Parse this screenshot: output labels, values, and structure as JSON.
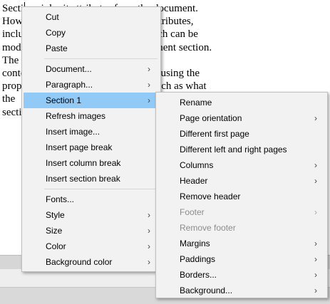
{
  "document": {
    "text": "Sections inherit attributes from the document.\nHowever, they can have their own attributes,\nincluding page size, orientation, which can be\nmodified independently of the document section. The\ncontent within a section is formatted using the\nproperties defined for that section, such as what the\nsection is"
  },
  "main_menu": {
    "cut": "Cut",
    "copy": "Copy",
    "paste": "Paste",
    "document": "Document...",
    "paragraph": "Paragraph...",
    "section": "Section 1",
    "refresh_images": "Refresh images",
    "insert_image": "Insert image...",
    "insert_page_break": "Insert page break",
    "insert_column_break": "Insert column break",
    "insert_section_break": "Insert section break",
    "fonts": "Fonts...",
    "style": "Style",
    "size": "Size",
    "color": "Color",
    "background_color": "Background color"
  },
  "section_menu": {
    "rename": "Rename",
    "page_orientation": "Page orientation",
    "different_first_page": "Different first page",
    "different_left_right": "Different left and right pages",
    "columns": "Columns",
    "header": "Header",
    "remove_header": "Remove header",
    "footer": "Footer",
    "remove_footer": "Remove footer",
    "margins": "Margins",
    "paddings": "Paddings",
    "borders": "Borders...",
    "background": "Background..."
  },
  "arrow_glyph": "›",
  "colors": {
    "menu_bg": "#f2f2f2",
    "highlight": "#91c9f7",
    "disabled_text": "#8c8c8c"
  }
}
